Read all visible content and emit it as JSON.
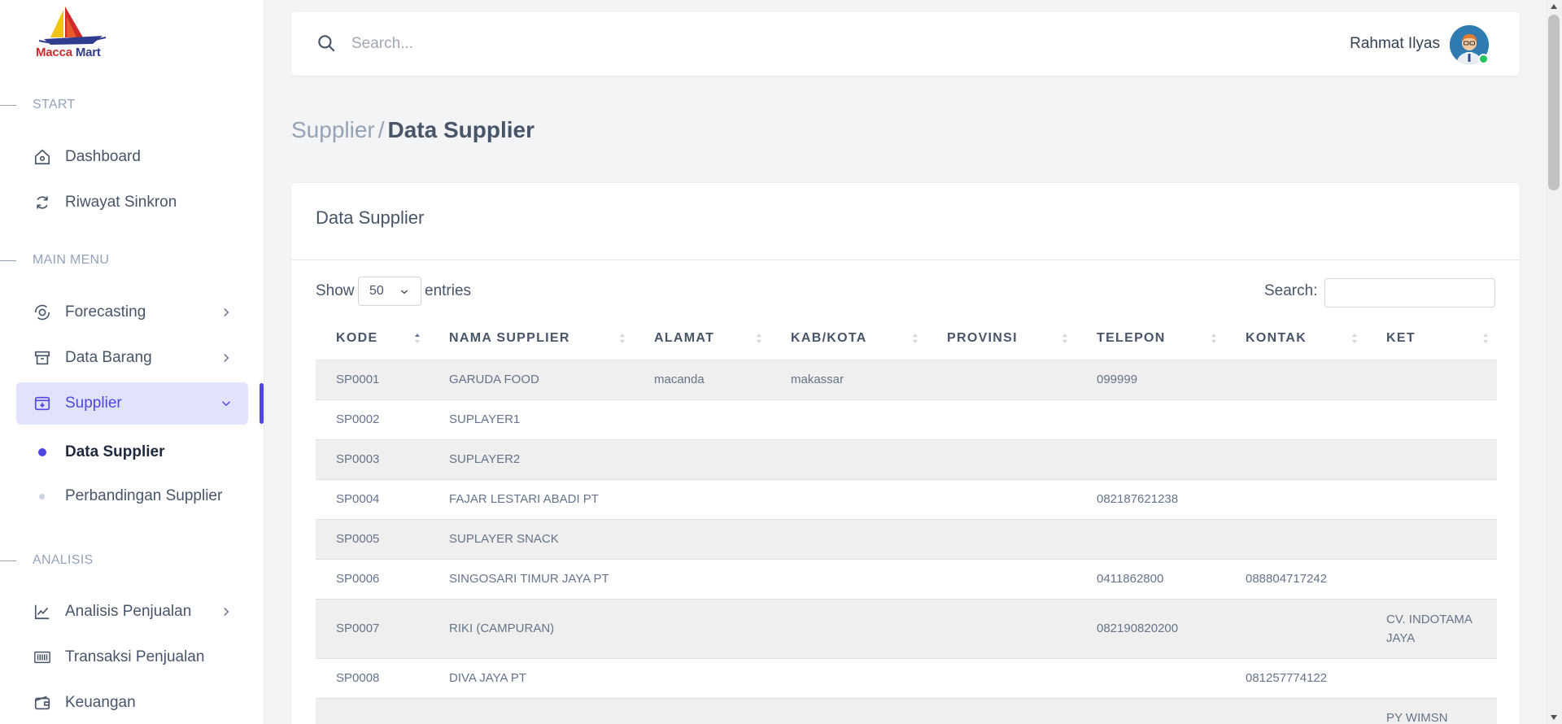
{
  "brand": {
    "name_part1": "Macca",
    "name_part2": "Mart"
  },
  "sidebar": {
    "sections": [
      {
        "label": "START"
      },
      {
        "label": "MAIN MENU"
      },
      {
        "label": "ANALISIS"
      }
    ],
    "items": [
      {
        "label": "Dashboard",
        "icon": "home-icon"
      },
      {
        "label": "Riwayat Sinkron",
        "icon": "sync-icon"
      },
      {
        "label": "Forecasting",
        "icon": "forecast-icon"
      },
      {
        "label": "Data Barang",
        "icon": "archive-icon"
      },
      {
        "label": "Supplier",
        "icon": "supplier-box-icon"
      },
      {
        "label": "Analisis Penjualan",
        "icon": "line-chart-icon"
      },
      {
        "label": "Transaksi Penjualan",
        "icon": "barcode-icon"
      },
      {
        "label": "Keuangan",
        "icon": "wallet-icon"
      }
    ],
    "subitems": [
      {
        "label": "Data Supplier"
      },
      {
        "label": "Perbandingan Supplier"
      }
    ],
    "accent_color": "#4f46e5"
  },
  "header": {
    "search_placeholder": "Search...",
    "user_name": "Rahmat Ilyas"
  },
  "breadcrumb": {
    "parent": "Supplier",
    "separator": "/",
    "current": "Data Supplier"
  },
  "card": {
    "title": "Data Supplier",
    "show_label": "Show",
    "entries_value": "50",
    "entries_label": "entries",
    "search_label": "Search:"
  },
  "table": {
    "columns": [
      "KODE",
      "NAMA SUPPLIER",
      "ALAMAT",
      "KAB/KOTA",
      "PROVINSI",
      "TELEPON",
      "KONTAK",
      "KET"
    ],
    "rows": [
      [
        "SP0001",
        "GARUDA FOOD",
        "macanda",
        "makassar",
        "",
        "099999",
        "",
        ""
      ],
      [
        "SP0002",
        "SUPLAYER1",
        "",
        "",
        "",
        "",
        "",
        ""
      ],
      [
        "SP0003",
        "SUPLAYER2",
        "",
        "",
        "",
        "",
        "",
        ""
      ],
      [
        "SP0004",
        "FAJAR LESTARI ABADI PT",
        "",
        "",
        "",
        "082187621238",
        "",
        ""
      ],
      [
        "SP0005",
        "SUPLAYER SNACK",
        "",
        "",
        "",
        "",
        "",
        ""
      ],
      [
        "SP0006",
        "SINGOSARI TIMUR JAYA PT",
        "",
        "",
        "",
        "0411862800",
        "088804717242",
        ""
      ],
      [
        "SP0007",
        "RIKI (CAMPURAN)",
        "",
        "",
        "",
        "082190820200",
        "",
        "CV. INDOTAMA JAYA"
      ],
      [
        "SP0008",
        "DIVA JAYA PT",
        "",
        "",
        "",
        "",
        "081257774122",
        ""
      ],
      [
        "",
        "",
        "",
        "",
        "",
        "",
        "",
        "PY WIMSN"
      ]
    ]
  }
}
